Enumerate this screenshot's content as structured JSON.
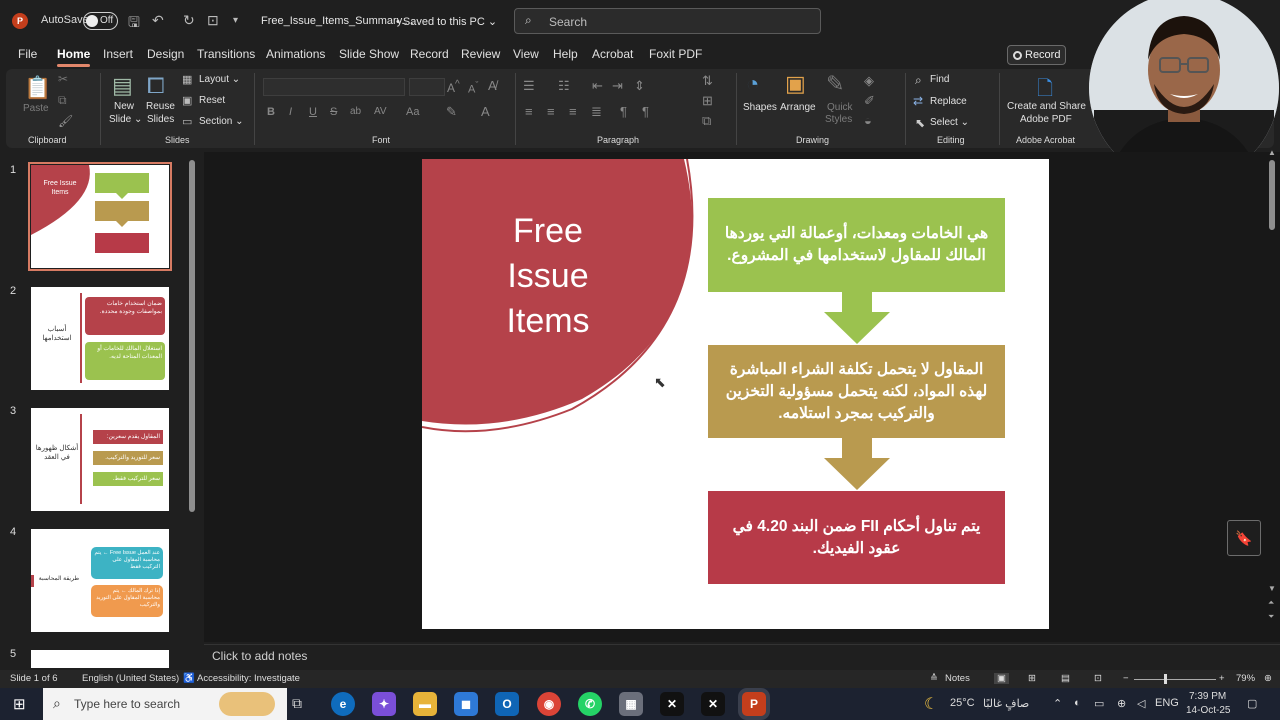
{
  "titlebar": {
    "autosave_label": "AutoSave",
    "autosave_state": "Off",
    "filename": "Free_Issue_Items_Summary....",
    "saved_status": "• Saved to this PC ⌄",
    "search_placeholder": "Search"
  },
  "tabs": [
    "File",
    "Home",
    "Insert",
    "Design",
    "Transitions",
    "Animations",
    "Slide Show",
    "Record",
    "Review",
    "View",
    "Help",
    "Acrobat",
    "Foxit PDF"
  ],
  "record_button": "Record",
  "ribbon": {
    "clipboard": {
      "label": "Clipboard",
      "paste": "Paste"
    },
    "slides": {
      "label": "Slides",
      "new_slide": "New",
      "new_slide2": "Slide ⌄",
      "reuse": "Reuse",
      "reuse2": "Slides",
      "layout": "Layout ⌄",
      "reset": "Reset",
      "section": "Section ⌄"
    },
    "font": {
      "label": "Font"
    },
    "paragraph": {
      "label": "Paragraph"
    },
    "drawing": {
      "label": "Drawing",
      "shapes": "Shapes",
      "arrange": "Arrange",
      "quick_styles": "Quick",
      "quick_styles2": "Styles"
    },
    "editing": {
      "label": "Editing",
      "find": "Find",
      "replace": "Replace",
      "select": "Select ⌄"
    },
    "acrobat": {
      "label": "Adobe Acrobat",
      "create": "Create and Share",
      "create2": "Adobe PDF"
    }
  },
  "thumbnails": [
    {
      "num": "1",
      "title": "Free Issue Items"
    },
    {
      "num": "2",
      "title": "أسباب استخدامها",
      "box1": "ضمان استخدام خامات بمواصفات وجودة محددة.",
      "box2": "استغلال المالك للخامات أو المعدات المتاحة لديه."
    },
    {
      "num": "3",
      "title": "أشكال ظهورها في العقد",
      "box1": "المقاول يقدم سعرين:",
      "box2": "سعر للتوريد والتركيب.",
      "box3": "سعر للتركيب فقط."
    },
    {
      "num": "4",
      "title": "طريقة المحاسبة",
      "box1": "عند العمل Free Issue ← يتم محاسبة المقاول على التركيب فقط",
      "box2": "إذا ترك المالك ← يتم محاسبة المقاول على التوريد والتركيب"
    },
    {
      "num": "5"
    }
  ],
  "slide": {
    "title": "Free Issue Items",
    "box1": "هي الخامات ومعدات، أوعمالة التي يوردها المالك للمقاول لاستخدامها في المشروع.",
    "box2": "المقاول لا يتحمل تكلفة الشراء المباشرة لهذه المواد، لكنه يتحمل مسؤولية التخزين والتركيب بمجرد استلامه.",
    "box3": "يتم تناول أحكام FII ضمن البند 4.20 في عقود الفيديك."
  },
  "notes_placeholder": "Click to add notes",
  "status": {
    "slide_info": "Slide 1 of 6",
    "language": "English (United States)",
    "accessibility": "Accessibility: Investigate",
    "notes": "Notes",
    "zoom": "79%"
  },
  "taskbar": {
    "search_placeholder": "Type here to search",
    "weather": "25°C",
    "weather_desc": "صافٍ غالبًا",
    "lang": "ENG",
    "time": "7:39 PM",
    "date": "14-Oct-25"
  },
  "colors": {
    "accent": "#e2876b",
    "slide_red": "#b5424a",
    "green": "#9bc24f",
    "gold": "#b99a4f",
    "red_box": "#b73a48"
  }
}
